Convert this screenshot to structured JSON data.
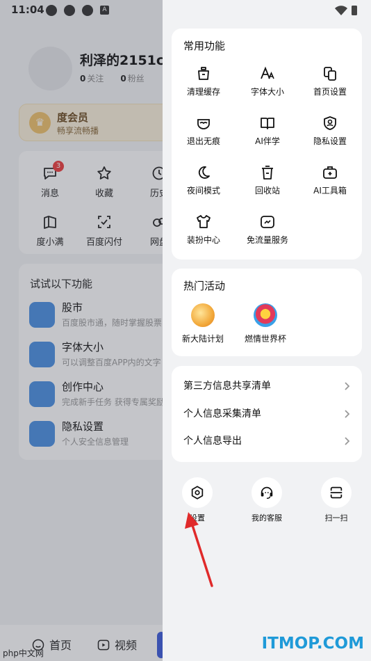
{
  "status": {
    "time": "11:04"
  },
  "profile": {
    "name": "利泽的2151c",
    "follow_count": "0",
    "follow_label": "关注",
    "fans_count": "0",
    "fans_label": "粉丝"
  },
  "vip": {
    "title": "度会员",
    "subtitle": "畅享流畅播"
  },
  "quick": [
    {
      "label": "消息",
      "icon": "message-icon",
      "badge": "3"
    },
    {
      "label": "收藏",
      "icon": "star-icon"
    },
    {
      "label": "历史",
      "icon": "clock-icon"
    },
    {
      "label": "度小满",
      "icon": "book-icon"
    },
    {
      "label": "百度闪付",
      "icon": "scan-pay-icon"
    },
    {
      "label": "网盘",
      "icon": "cloud-icon"
    }
  ],
  "try_features": {
    "title": "试试以下功能",
    "items": [
      {
        "title": "股市",
        "subtitle": "百度股市通，随时掌握股票",
        "icon": "stock-icon"
      },
      {
        "title": "字体大小",
        "subtitle": "可以调整百度APP内的文字",
        "icon": "font-icon"
      },
      {
        "title": "创作中心",
        "subtitle": "完成新手任务 获得专属奖励",
        "icon": "creator-icon"
      },
      {
        "title": "隐私设置",
        "subtitle": "个人安全信息管理",
        "icon": "mask-icon"
      }
    ]
  },
  "tabbar": {
    "home": "首页",
    "video": "视频"
  },
  "drawer": {
    "common": {
      "title": "常用功能",
      "items": [
        {
          "label": "清理缓存",
          "icon": "broom-icon"
        },
        {
          "label": "字体大小",
          "icon": "font-size-icon"
        },
        {
          "label": "首页设置",
          "icon": "home-settings-icon"
        },
        {
          "label": "退出无痕",
          "icon": "incognito-icon"
        },
        {
          "label": "AI伴学",
          "icon": "open-book-icon"
        },
        {
          "label": "隐私设置",
          "icon": "privacy-shield-icon"
        },
        {
          "label": "夜间模式",
          "icon": "moon-icon"
        },
        {
          "label": "回收站",
          "icon": "trash-icon"
        },
        {
          "label": "AI工具箱",
          "icon": "toolbox-icon"
        },
        {
          "label": "装扮中心",
          "icon": "tshirt-icon"
        },
        {
          "label": "免流量服务",
          "icon": "data-card-icon"
        }
      ]
    },
    "hot": {
      "title": "热门活动",
      "items": [
        {
          "label": "新大陆计划",
          "icon": "rocket-coin-icon"
        },
        {
          "label": "燃情世界杯",
          "icon": "football-icon"
        }
      ]
    },
    "links": [
      {
        "label": "第三方信息共享清单"
      },
      {
        "label": "个人信息采集清单"
      },
      {
        "label": "个人信息导出"
      }
    ],
    "bottom": [
      {
        "label": "设置",
        "icon": "settings-icon"
      },
      {
        "label": "我的客服",
        "icon": "headset-icon"
      },
      {
        "label": "扫一扫",
        "icon": "scan-icon"
      }
    ]
  },
  "watermark": {
    "site": "ITMOP.COM",
    "left": "php中文网"
  },
  "colors": {
    "accent_blue": "#4a90e2",
    "annotation_red": "#e02a2a",
    "badge_red": "#ee3d3d",
    "watermark_blue": "#1f9ad8"
  }
}
